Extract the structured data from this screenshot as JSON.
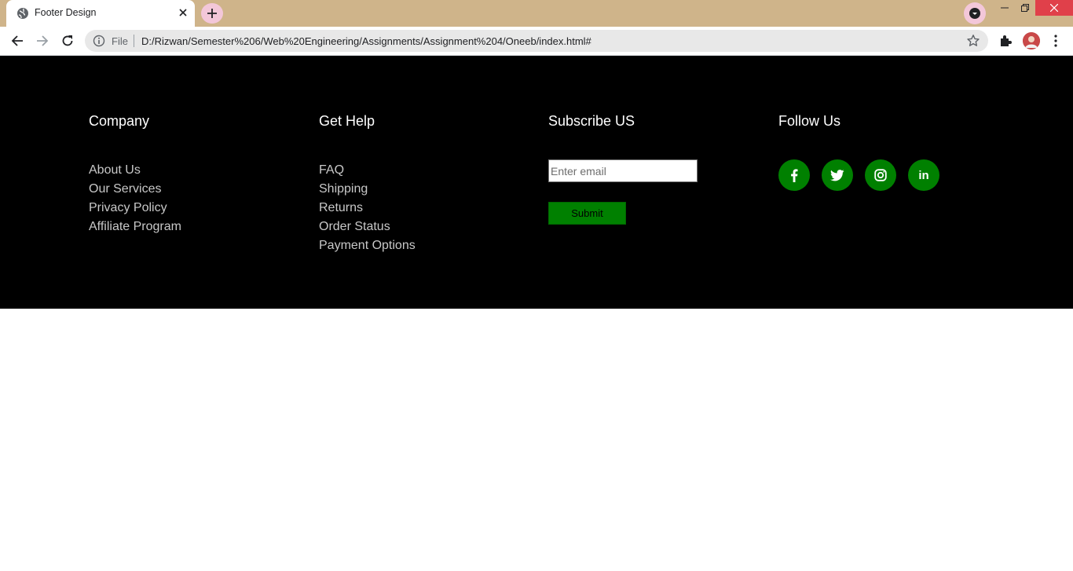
{
  "browser": {
    "tab_title": "Footer Design",
    "scheme_label": "File",
    "url": "D:/Rizwan/Semester%206/Web%20Engineering/Assignments/Assignment%204/Oneeb/index.html#"
  },
  "footer": {
    "background": "#000000",
    "accent": "#008000",
    "company": {
      "heading": "Company",
      "links": [
        "About Us",
        "Our Services",
        "Privacy Policy",
        "Affiliate Program"
      ]
    },
    "help": {
      "heading": "Get Help",
      "links": [
        "FAQ",
        "Shipping",
        "Returns",
        "Order Status",
        "Payment Options"
      ]
    },
    "subscribe": {
      "heading": "Subscribe US",
      "email_placeholder": "Enter email",
      "submit_label": "Submit"
    },
    "follow": {
      "heading": "Follow Us",
      "icons": [
        "facebook-icon",
        "twitter-icon",
        "instagram-icon",
        "linkedin-icon"
      ],
      "linkedin_glyph": "in"
    }
  }
}
